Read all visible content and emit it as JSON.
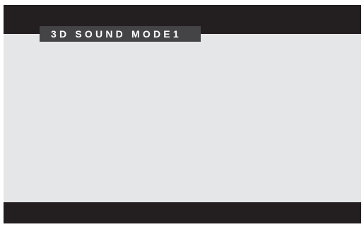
{
  "screen": {
    "mode_label": "3D SOUND MODE1"
  },
  "colors": {
    "frame": "#231f20",
    "content_background": "#e5e6e7",
    "label_background": "#444446",
    "label_text": "#ffffff"
  }
}
